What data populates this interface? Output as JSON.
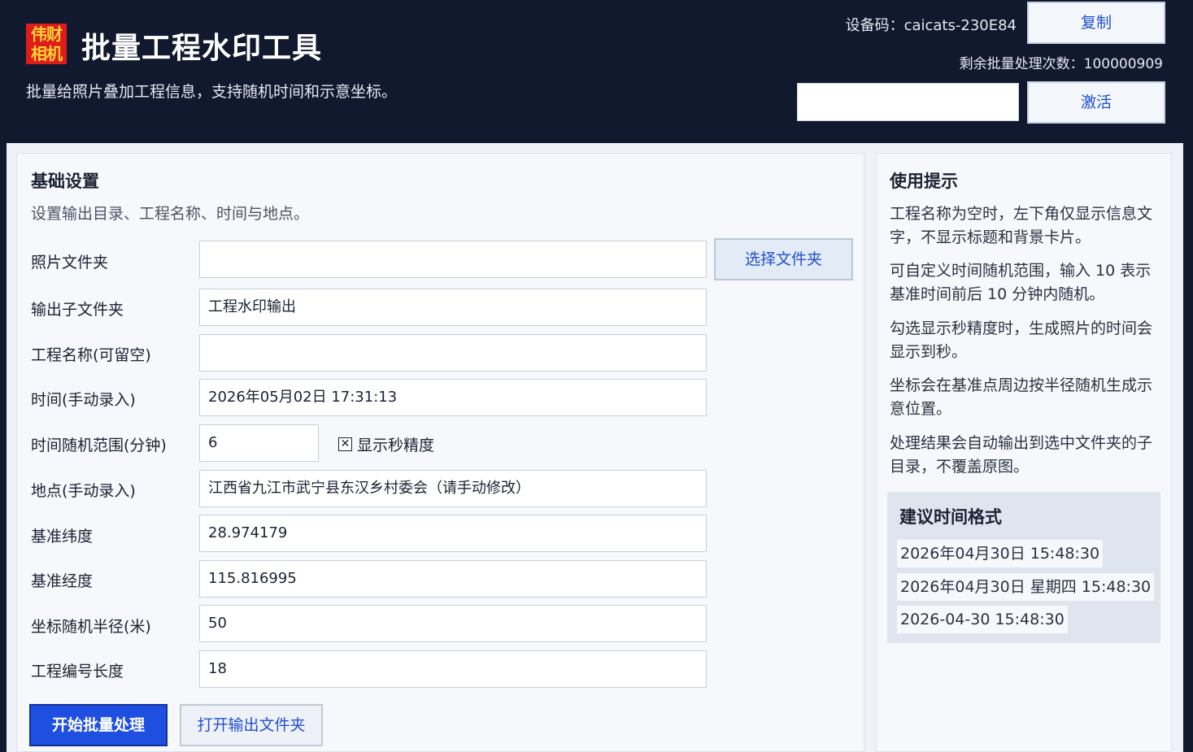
{
  "header": {
    "logo_line1": "伟财",
    "logo_line2": "相机",
    "title": "批量工程水印工具",
    "subtitle": "批量给照片叠加工程信息，支持随机时间和示意坐标。",
    "device_code": "设备码：caicats-230E84",
    "copy_label": "复制",
    "remaining": "剩余批量处理次数：100000909",
    "activate_value": "",
    "activate_label": "激活"
  },
  "basic": {
    "title": "基础设置",
    "desc": "设置输出目录、工程名称、时间与地点。",
    "fields": [
      {
        "label": "照片文件夹",
        "value": ""
      },
      {
        "label": "输出子文件夹",
        "value": "工程水印输出"
      },
      {
        "label": "工程名称(可留空)",
        "value": ""
      },
      {
        "label": "时间(手动录入)",
        "value": "2026年05月02日 17:31:13"
      },
      {
        "label": "时间随机范围(分钟)",
        "value": "6"
      },
      {
        "label": "地点(手动录入)",
        "value": "江西省九江市武宁县东汉乡村委会（请手动修改）"
      },
      {
        "label": "基准纬度",
        "value": "28.974179"
      },
      {
        "label": "基准经度",
        "value": "115.816995"
      },
      {
        "label": "坐标随机半径(米)",
        "value": "50"
      },
      {
        "label": "工程编号长度",
        "value": "18"
      }
    ],
    "choose_folder_label": "选择文件夹",
    "show_seconds_label": "显示秒精度",
    "show_seconds_checked": true,
    "start_label": "开始批量处理",
    "open_output_label": "打开输出文件夹"
  },
  "tips": {
    "title": "使用提示",
    "items": [
      "工程名称为空时，左下角仅显示信息文字，不显示标题和背景卡片。",
      "可自定义时间随机范围，输入 10 表示基准时间前后 10 分钟内随机。",
      "勾选显示秒精度时，生成照片的时间会显示到秒。",
      "坐标会在基准点周边按半径随机生成示意位置。",
      "处理结果会自动输出到选中文件夹的子目录，不覆盖原图。"
    ],
    "format_title": "建议时间格式",
    "formats": [
      "2026年04月30日 15:48:30",
      "2026年04月30日 星期四 15:48:30",
      "2026-04-30 15:48:30"
    ]
  }
}
